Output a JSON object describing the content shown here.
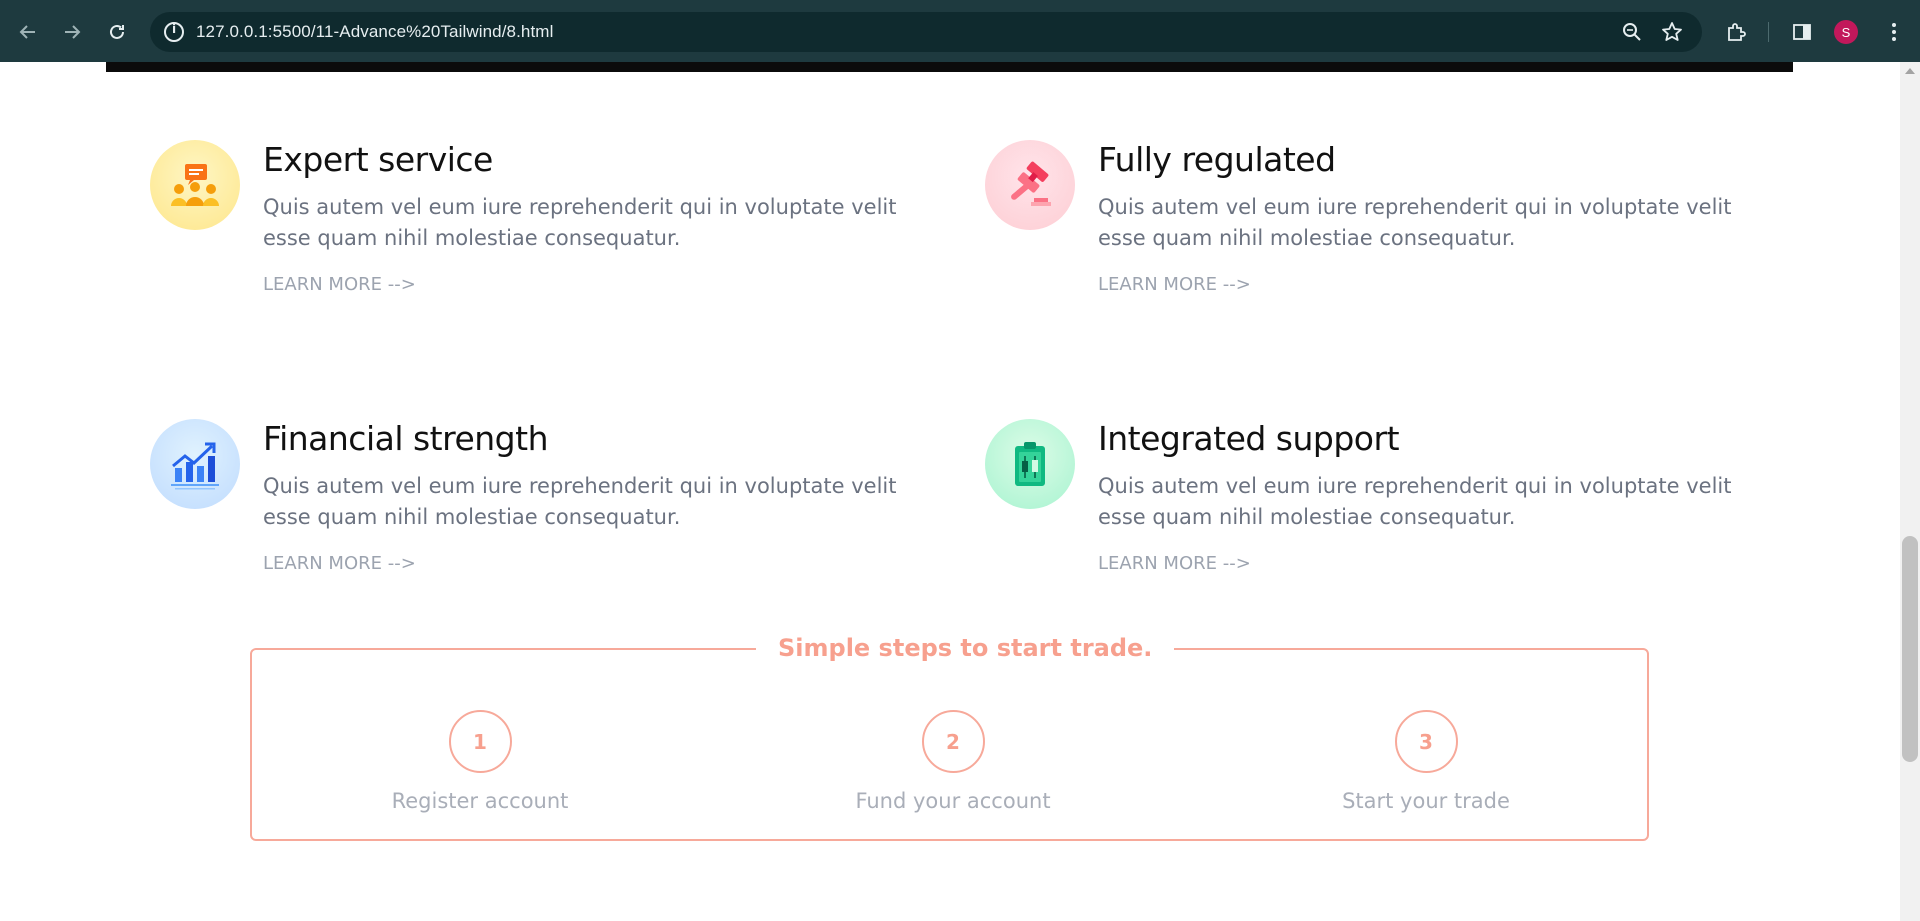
{
  "browser": {
    "url": "127.0.0.1:5500/11-Advance%20Tailwind/8.html",
    "profile_initial": "S",
    "icons": [
      "back-icon",
      "forward-icon",
      "reload-icon",
      "site-info-icon",
      "zoom-icon",
      "bookmark-star-icon",
      "extensions-icon",
      "side-panel-icon",
      "menu-dots-icon"
    ]
  },
  "features": [
    {
      "title": "Expert service",
      "description": "Quis autem vel eum iure reprehenderit qui in voluptate velit esse quam nihil molestiae consequatur.",
      "link": "LEARN MORE -->",
      "icon": "support-team-icon"
    },
    {
      "title": "Fully regulated",
      "description": "Quis autem vel eum iure reprehenderit qui in voluptate velit esse quam nihil molestiae consequatur.",
      "link": "LEARN MORE -->",
      "icon": "gavel-icon"
    },
    {
      "title": "Financial strength",
      "description": "Quis autem vel eum iure reprehenderit qui in voluptate velit esse quam nihil molestiae consequatur.",
      "link": "LEARN MORE -->",
      "icon": "growth-chart-icon"
    },
    {
      "title": "Integrated support",
      "description": "Quis autem vel eum iure reprehenderit qui in voluptate velit esse quam nihil molestiae consequatur.",
      "link": "LEARN MORE -->",
      "icon": "clipboard-candlestick-icon"
    }
  ],
  "steps": {
    "title": "Simple steps to start trade.",
    "items": [
      {
        "number": "1",
        "label": "Register account"
      },
      {
        "number": "2",
        "label": "Fund your account"
      },
      {
        "number": "3",
        "label": "Start your trade"
      }
    ]
  },
  "colors": {
    "chrome_bg": "#1e3a3f",
    "accent_salmon": "#f7a08e",
    "text_muted": "#6b7280"
  }
}
